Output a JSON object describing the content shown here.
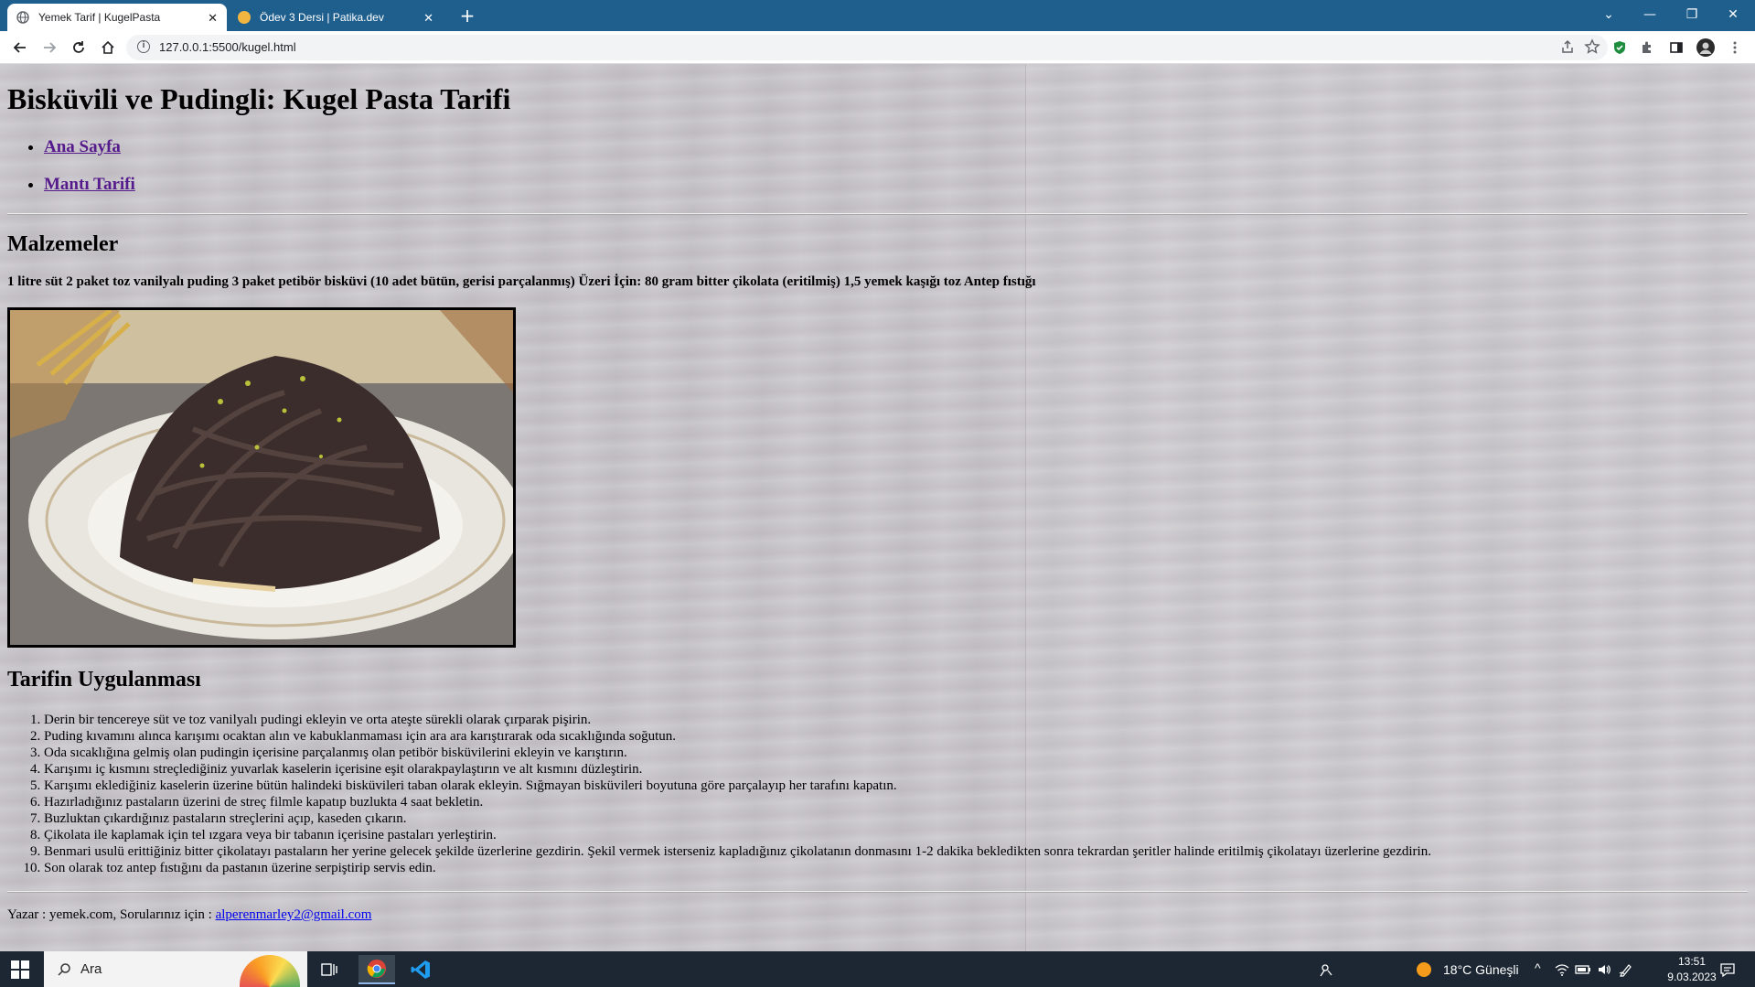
{
  "browser": {
    "tabs": [
      {
        "title": "Yemek Tarif | KugelPasta",
        "active": true
      },
      {
        "title": "Ödev 3 Dersi | Patika.dev",
        "active": false
      }
    ],
    "close_glyph": "✕",
    "new_tab_glyph": "+",
    "address": "127.0.0.1:5500/kugel.html",
    "info_glyph": "i",
    "window_controls": {
      "dropdown": "⌄",
      "minimize": "—",
      "restore": "❐",
      "close": "✕"
    }
  },
  "page": {
    "title": "Bisküvili ve Pudingli: Kugel Pasta Tarifi",
    "nav": [
      {
        "label": "Ana Sayfa"
      },
      {
        "label": "Mantı Tarifi"
      }
    ],
    "ingredients_heading": "Malzemeler",
    "ingredients_text": "1 litre süt 2 paket toz vanilyalı puding 3 paket petibör bisküvi (10 adet bütün, gerisi parçalanmış) Üzeri İçin: 80 gram bitter çikolata (eritilmiş) 1,5 yemek kaşığı toz Antep fıstığı",
    "steps_heading": "Tarifin Uygulanması",
    "steps": [
      "Derin bir tencereye süt ve toz vanilyalı pudingi ekleyin ve orta ateşte sürekli olarak çırparak pişirin.",
      "Puding kıvamını alınca karışımı ocaktan alın ve kabuklanmaması için ara ara karıştırarak oda sıcaklığında soğutun.",
      "Oda sıcaklığına gelmiş olan pudingin içerisine parçalanmış olan petibör bisküvilerini ekleyin ve karıştırın.",
      "Karışımı iç kısmını streçlediğiniz yuvarlak kaselerin içerisine eşit olarakpaylaştırın ve alt kısmını düzleştirin.",
      "Karışımı eklediğiniz kaselerin üzerine bütün halindeki bisküvileri taban olarak ekleyin. Sığmayan bisküvileri boyutuna göre parçalayıp her tarafını kapatın.",
      "Hazırladığınız pastaların üzerini de streç filmle kapatıp buzlukta 4 saat bekletin.",
      "Buzluktan çıkardığınız pastaların streçlerini açıp, kaseden çıkarın.",
      "Çikolata ile kaplamak için tel ızgara veya bir tabanın içerisine pastaları yerleştirin.",
      "Benmari usulü erittiğiniz bitter çikolatayı pastaların her yerine gelecek şekilde üzerlerine gezdirin. Şekil vermek isterseniz kapladığınız çikolatanın donmasını 1-2 dakika bekledikten sonra tekrardan şeritler halinde eritilmiş çikolatayı üzerlerine gezdirin.",
      "Son olarak toz antep fıstığını da pastanın üzerine serpiştirip servis edin."
    ],
    "footer_text": "Yazar : yemek.com, Sorularınız için : ",
    "footer_email": "alperenmarley2@gmail.com"
  },
  "taskbar": {
    "search_placeholder": "Ara",
    "weather": "18°C  Güneşli",
    "time": "13:51",
    "date": "9.03.2023"
  },
  "colors": {
    "tabstrip": "#1f5f8e",
    "link_visited": "#551a8b",
    "link": "#0000ee"
  }
}
